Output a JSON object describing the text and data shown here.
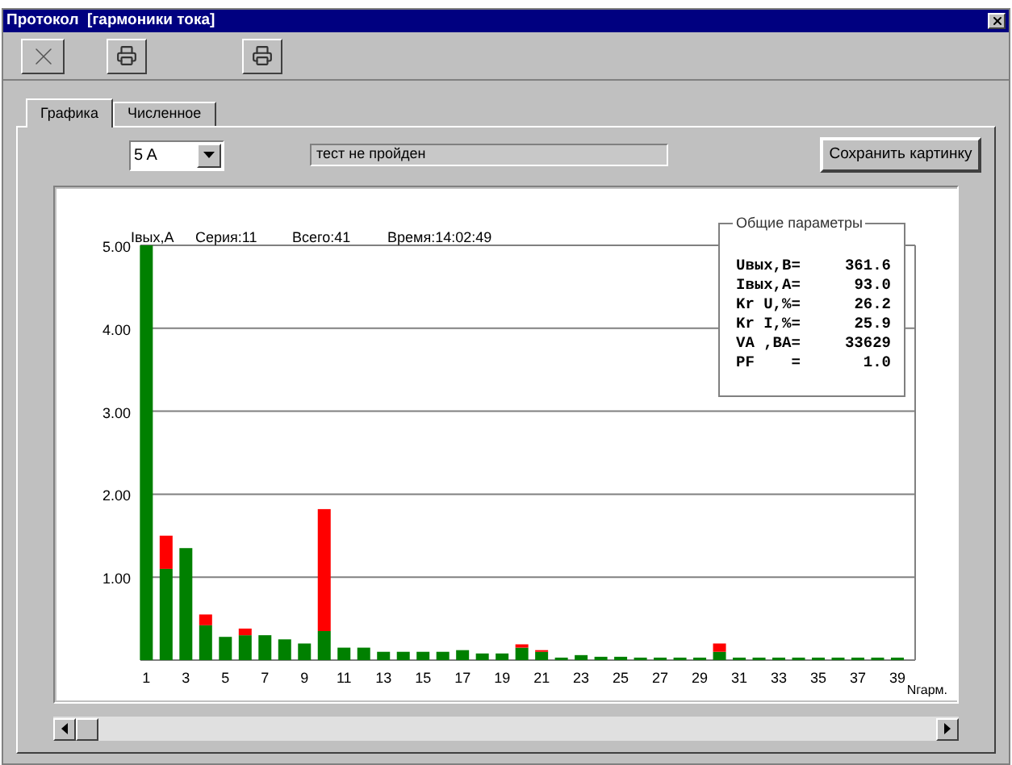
{
  "window": {
    "title": "Протокол  [гармоники тока]"
  },
  "tabs": [
    {
      "label": "Графика",
      "selected": true
    },
    {
      "label": "Численное",
      "selected": false
    }
  ],
  "current_select": {
    "value": "5 A"
  },
  "status_field": {
    "value": "тест не пройден"
  },
  "save_button": {
    "label": "Сохранить картинку"
  },
  "chart": {
    "header": [
      "Серия:11",
      "Всего:41",
      "Время:14:02:49"
    ],
    "chart_data": {
      "type": "bar",
      "stacked": true,
      "ylabel": "Iвых,А",
      "xlabel": "Nгарм.",
      "ylim": [
        0,
        5
      ],
      "yticks": [
        {
          "value": 1,
          "label": "1.00"
        },
        {
          "value": 2,
          "label": "2.00"
        },
        {
          "value": 3,
          "label": "3.00"
        },
        {
          "value": 4,
          "label": "4.00"
        },
        {
          "value": 5,
          "label": "5.00"
        }
      ],
      "xticks": [
        1,
        3,
        5,
        7,
        9,
        11,
        13,
        15,
        17,
        19,
        21,
        23,
        25,
        27,
        29,
        31,
        33,
        35,
        37,
        39
      ],
      "grid": true,
      "xlim": [
        0.7,
        39.9
      ],
      "x": [
        1,
        2,
        3,
        4,
        5,
        6,
        7,
        8,
        9,
        10,
        11,
        12,
        13,
        14,
        15,
        16,
        17,
        18,
        19,
        20,
        21,
        22,
        23,
        24,
        25,
        26,
        27,
        28,
        29,
        30,
        31,
        32,
        33,
        34,
        35,
        36,
        37,
        38,
        39
      ],
      "series": [
        {
          "color": "#008000",
          "values": [
            5.0,
            1.1,
            1.35,
            0.42,
            0.28,
            0.3,
            0.3,
            0.25,
            0.2,
            0.35,
            0.15,
            0.15,
            0.1,
            0.1,
            0.1,
            0.1,
            0.12,
            0.08,
            0.08,
            0.15,
            0.1,
            0.03,
            0.06,
            0.04,
            0.04,
            0.03,
            0.03,
            0.03,
            0.03,
            0.1,
            0.03,
            0.03,
            0.03,
            0.03,
            0.03,
            0.03,
            0.03,
            0.03,
            0.03
          ]
        },
        {
          "color": "#ff0000",
          "values": [
            0,
            0.4,
            0,
            0.13,
            0,
            0.08,
            0,
            0,
            0,
            1.47,
            0,
            0,
            0,
            0,
            0,
            0,
            0,
            0,
            0,
            0.04,
            0.02,
            0,
            0,
            0,
            0,
            0,
            0,
            0,
            0,
            0.1,
            0,
            0,
            0,
            0,
            0,
            0,
            0,
            0,
            0
          ]
        }
      ]
    }
  },
  "parameters": {
    "title": "Общие параметры",
    "rows": [
      {
        "label": "Uвых,В=",
        "value": "361.6"
      },
      {
        "label": "Iвых,А=",
        "value": "93.0"
      },
      {
        "label": "Kr U,%=",
        "value": "26.2"
      },
      {
        "label": "Kr I,%=",
        "value": "25.9"
      },
      {
        "label": "VA ,ВА=",
        "value": "33629"
      },
      {
        "label": "PF    =",
        "value": "1.0"
      }
    ]
  }
}
